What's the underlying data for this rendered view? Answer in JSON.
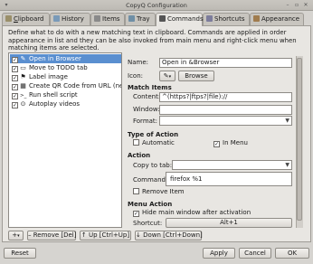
{
  "window": {
    "title": "CopyQ Configuration"
  },
  "tabs": [
    {
      "label": "Clipboard",
      "icon": "clipboard-icon"
    },
    {
      "label": "History",
      "icon": "history-icon"
    },
    {
      "label": "Items",
      "icon": "items-icon"
    },
    {
      "label": "Tray",
      "icon": "tray-icon"
    },
    {
      "label": "Commands",
      "icon": "commands-icon"
    },
    {
      "label": "Shortcuts",
      "icon": "shortcuts-icon"
    },
    {
      "label": "Appearance",
      "icon": "appearance-icon"
    }
  ],
  "description": "Define what to do with a new matching text in clipboard. Commands are applied in order appearance in list and they can be also invoked from main menu and right-click menu when matching items are selected.",
  "commands": [
    {
      "label": "Open in Browser",
      "icon": "✎",
      "checked": true,
      "selected": true
    },
    {
      "label": "Move to TODO tab",
      "icon": "▭",
      "checked": true
    },
    {
      "label": "Label image",
      "icon": "⚑",
      "checked": true
    },
    {
      "label": "Create QR Code from URL (nee",
      "icon": "▦",
      "checked": true
    },
    {
      "label": "Run shell script",
      "icon": ">_",
      "checked": true
    },
    {
      "label": "Autoplay videos",
      "icon": "⊙",
      "checked": true
    }
  ],
  "form": {
    "name_label": "Name:",
    "name_value": "Open in &Browser",
    "icon_label": "Icon:",
    "icon_value": "✎",
    "browse_label": "Browse",
    "match_items_title": "Match Items",
    "content_label": "Content:",
    "content_value": "^(https?|ftps?|file)://",
    "window_label": "Window:",
    "window_value": "",
    "format_label": "Format:",
    "format_value": "",
    "type_of_action_title": "Type of Action",
    "automatic_label": "Automatic",
    "in_menu_label": "In Menu",
    "action_title": "Action",
    "copy_to_tab_label": "Copy to tab:",
    "copy_to_tab_value": "",
    "command_label": "Command:",
    "command_value": "firefox %1",
    "remove_item_label": "Remove Item",
    "menu_action_title": "Menu Action",
    "hide_main_window_label": "Hide main window after activation",
    "shortcut_label": "Shortcut:",
    "shortcut_value": "Alt+1"
  },
  "list_buttons": {
    "add_label": "+",
    "remove_label": "Remove [Del]",
    "up_label": "Up [Ctrl+Up]",
    "down_label": "Down [Ctrl+Down]"
  },
  "dialog_buttons": {
    "reset_label": "Reset",
    "apply_label": "Apply",
    "cancel_label": "Cancel",
    "ok_label": "OK"
  }
}
